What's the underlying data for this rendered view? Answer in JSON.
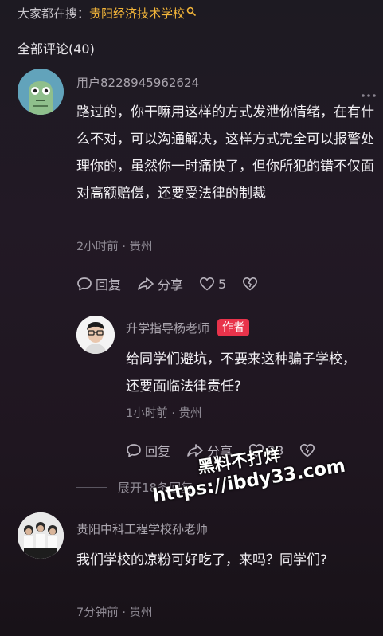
{
  "search_bar": {
    "prefix": "大家都在搜：",
    "keyword": "贵阳经济技术学校",
    "icon": "search-icon"
  },
  "comments_header": {
    "label": "全部评论(40)"
  },
  "comments": [
    {
      "username": "用户8228945962624",
      "text": "路过的，你干嘛用这样的方式发泄你情绪，在有什么不对，可以沟通解决，这样方式完全可以报警处理你的，虽然你一时痛快了，但你所犯的错不仅面对高额赔偿，还要受法律的制裁",
      "meta": "2小时前 · 贵州",
      "reply_label": "回复",
      "share_label": "分享",
      "like_count": "5",
      "more_icon": "more-dots-icon"
    },
    {
      "username": "升学指导杨老师",
      "badge": "作者",
      "text": "给同学们避坑，不要来这种骗子学校，还要面临法律责任?",
      "meta": "1小时前 · 贵州",
      "reply_label": "回复",
      "share_label": "分享",
      "like_count": "23"
    },
    {
      "username": "贵阳中科工程学校孙老师",
      "text": "我们学校的凉粉可好吃了，来吗？同学们?",
      "meta": "7分钟前 · 贵州"
    }
  ],
  "expand_replies": {
    "label": "展开18条回复"
  },
  "watermark": {
    "line1": "黑料不打烊",
    "line2": "https://ibdy33.com"
  },
  "colors": {
    "keyword": "#f4b63a",
    "author_badge": "#e8334b",
    "background": "#1f1820"
  }
}
